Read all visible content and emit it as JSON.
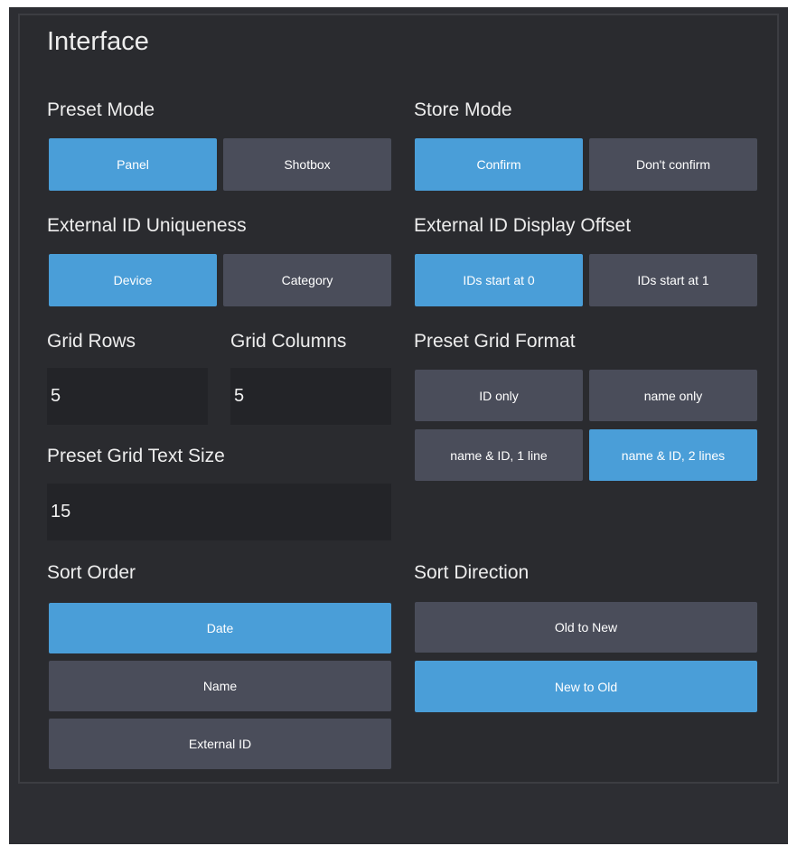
{
  "title": "Interface",
  "preset_mode": {
    "label": "Preset Mode",
    "options": [
      {
        "label": "Panel",
        "selected": true
      },
      {
        "label": "Shotbox",
        "selected": false
      }
    ]
  },
  "store_mode": {
    "label": "Store Mode",
    "options": [
      {
        "label": "Confirm",
        "selected": true
      },
      {
        "label": "Don't confirm",
        "selected": false
      }
    ]
  },
  "external_id_uniqueness": {
    "label": "External ID Uniqueness",
    "options": [
      {
        "label": "Device",
        "selected": true
      },
      {
        "label": "Category",
        "selected": false
      }
    ]
  },
  "external_id_display_offset": {
    "label": "External ID Display Offset",
    "options": [
      {
        "label": "IDs start at 0",
        "selected": true
      },
      {
        "label": "IDs start at 1",
        "selected": false
      }
    ]
  },
  "grid_rows": {
    "label": "Grid Rows",
    "value": "5"
  },
  "grid_columns": {
    "label": "Grid Columns",
    "value": "5"
  },
  "preset_grid_format": {
    "label": "Preset Grid Format",
    "options": [
      {
        "label": "ID only",
        "selected": false
      },
      {
        "label": "name only",
        "selected": false
      },
      {
        "label": "name & ID, 1 line",
        "selected": false
      },
      {
        "label": "name & ID, 2 lines",
        "selected": true
      }
    ]
  },
  "preset_grid_text_size": {
    "label": "Preset Grid Text Size",
    "value": "15"
  },
  "sort_order": {
    "label": "Sort Order",
    "options": [
      {
        "label": "Date",
        "selected": true
      },
      {
        "label": "Name",
        "selected": false
      },
      {
        "label": "External ID",
        "selected": false
      }
    ]
  },
  "sort_direction": {
    "label": "Sort Direction",
    "options": [
      {
        "label": "Old to New",
        "selected": false
      },
      {
        "label": "New to Old",
        "selected": true
      }
    ]
  },
  "colors": {
    "background": "#2a2b2f",
    "button": "#4a4d5a",
    "button_active": "#4a9ed8",
    "input_bg": "#232428",
    "text": "#ededed"
  }
}
